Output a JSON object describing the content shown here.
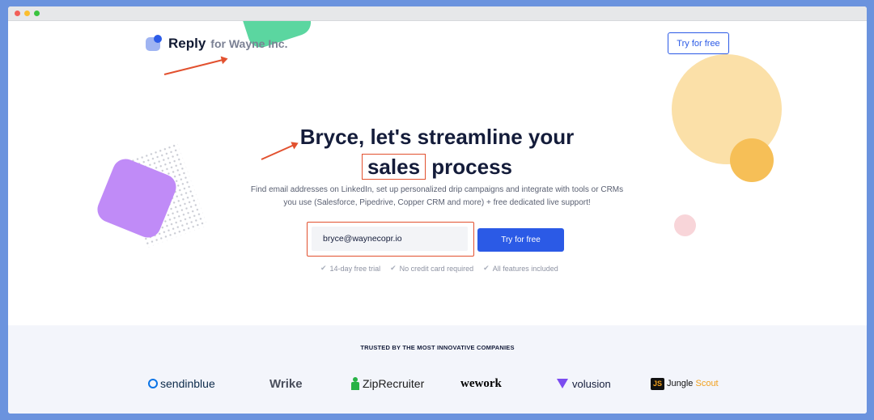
{
  "brand": {
    "name": "Reply",
    "for_text": "for Wayne Inc."
  },
  "nav": {
    "cta_label": "Try for free"
  },
  "hero": {
    "headline_line1": "Bryce, let's streamline your",
    "headline_highlight": "sales",
    "headline_tail": "process",
    "subtitle_line1": "Find email addresses on LinkedIn, set up personalized drip campaigns and integrate with tools or CRMs",
    "subtitle_line2": "you use (Salesforce, Pipedrive, Copper CRM and more) + free dedicated live support!",
    "email_value": "bryce@waynecopr.io",
    "cta_label": "Try for free",
    "benefits": [
      "14-day free trial",
      "No credit card required",
      "All features included"
    ]
  },
  "trusted": {
    "title": "TRUSTED BY THE MOST INNOVATIVE COMPANIES",
    "logos": [
      "sendinblue",
      "Wrike",
      "ZipRecruiter",
      "wework",
      "volusion",
      "Jungle",
      "Scout"
    ]
  },
  "colors": {
    "primary": "#2b5ae6",
    "annotation": "#e2512f",
    "heading": "#141c3a",
    "frame": "#6b93de",
    "trusted_bg": "#f3f5fb"
  }
}
